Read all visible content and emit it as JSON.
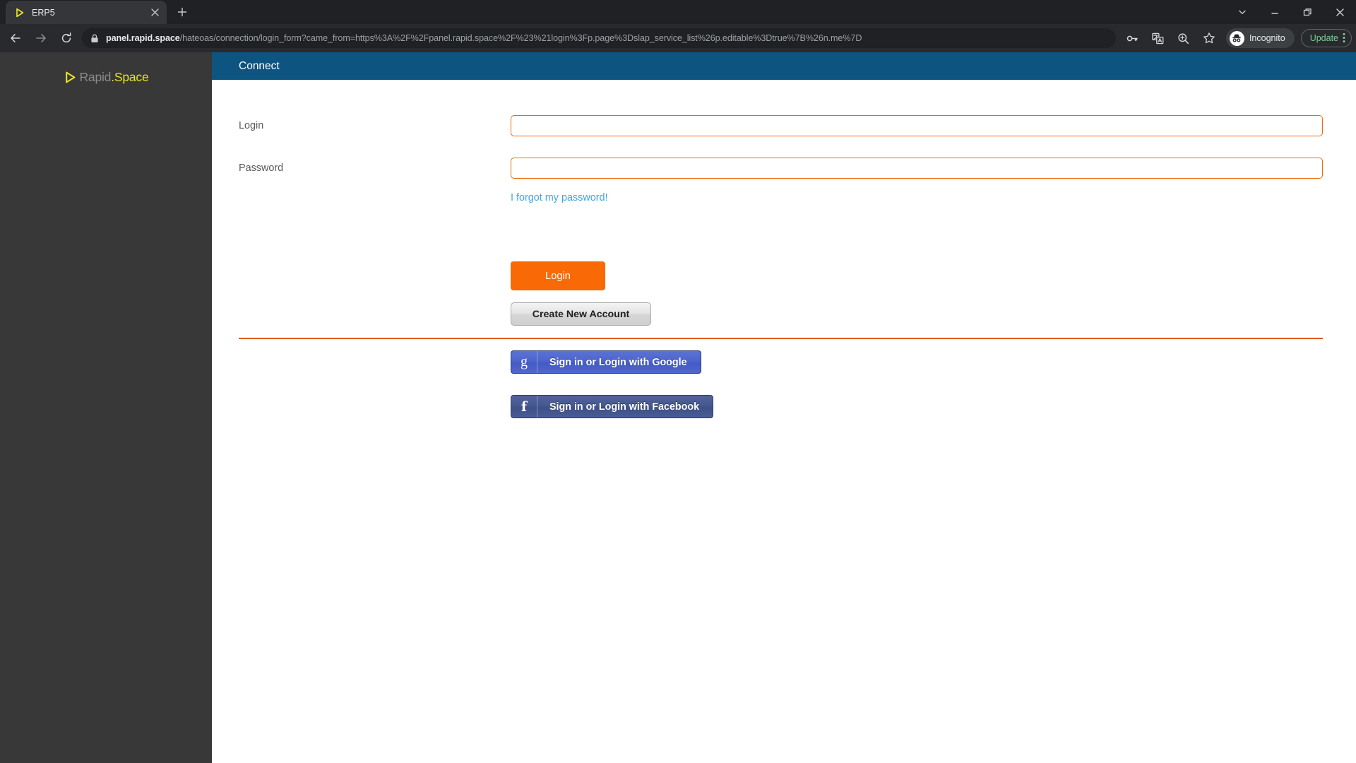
{
  "browser": {
    "tab": {
      "title": "ERP5",
      "favicon_icon": "rapidspace-play-triangle-icon",
      "close_icon": "close-icon"
    },
    "new_tab_icon": "plus-icon",
    "window_controls": {
      "tab_search_icon": "chevron-down-icon",
      "minimize_icon": "minimize-icon",
      "restore_icon": "restore-window-icon",
      "close_icon": "close-window-icon"
    },
    "nav": {
      "back_icon": "arrow-back-icon",
      "forward_icon": "arrow-forward-icon",
      "reload_icon": "reload-icon"
    },
    "omnibox": {
      "lock_icon": "lock-icon",
      "url_host": "panel.rapid.space",
      "url_path": "/hateoas/connection/login_form?came_from=https%3A%2F%2Fpanel.rapid.space%2F%23%21login%3Fp.page%3Dslap_service_list%26p.editable%3Dtrue%7B%26n.me%7D"
    },
    "toolbar_right": {
      "password_manager_icon": "key-icon",
      "translate_icon": "translate-icon",
      "zoom_icon": "zoom-magnifier-icon",
      "bookmark_icon": "star-icon",
      "profile_icon": "incognito-icon",
      "profile_label": "Incognito",
      "update_label": "Update",
      "menu_icon": "three-dot-menu-icon"
    }
  },
  "sidebar": {
    "logo": {
      "mark_icon": "rapidspace-play-triangle-icon",
      "text_primary": "Rapid",
      "text_accent": ".Space"
    }
  },
  "page": {
    "header": {
      "title": "Connect"
    },
    "form": {
      "login": {
        "label": "Login",
        "value": "",
        "placeholder": ""
      },
      "password": {
        "label": "Password",
        "value": "",
        "placeholder": ""
      },
      "forgot_password_label": "I forgot my password!",
      "login_button_label": "Login",
      "create_account_button_label": "Create New Account"
    },
    "social": {
      "google": {
        "icon": "google-g-icon",
        "glyph": "g",
        "label": "Sign in or Login with Google"
      },
      "facebook": {
        "icon": "facebook-f-icon",
        "glyph": "f",
        "label": "Sign in or Login with Facebook"
      }
    }
  },
  "colors": {
    "accent_orange": "#f96a06",
    "border_orange": "#ed6a0c",
    "header_blue": "#0d5480",
    "link_blue": "#47a3e3",
    "sidebar_dark": "#383838",
    "logo_yellow": "#e8e224"
  }
}
